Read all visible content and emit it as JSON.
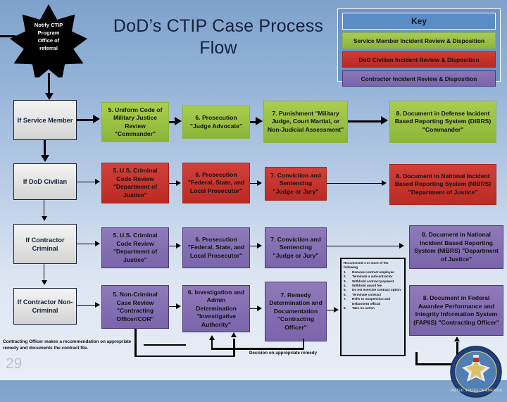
{
  "slide": {
    "title": "DoD’s CTIP Case Process Flow",
    "page_number": "29",
    "background_colors": {
      "top": "#7fa2cc",
      "bottom": "#e8eef7"
    }
  },
  "star_callout": {
    "name": "notify-ctip-star",
    "text": "Notify CTIP Program Office of referral",
    "lines": [
      "Notify CTIP",
      "Program",
      "Office of",
      "referral"
    ],
    "fill": "#000000",
    "text_color": "#ffffff"
  },
  "key": {
    "header": "Key",
    "items": [
      {
        "label": "Service Member Incident Review & Disposition",
        "color": "#a8cc4f",
        "swatch": "green"
      },
      {
        "label": "DoD Civilian Incident Review & Disposition",
        "color": "#cf3b33",
        "swatch": "red"
      },
      {
        "label": "Contractor Incident Review & Disposition",
        "color": "#8b76b8",
        "swatch": "purple"
      }
    ],
    "panel_color": "#6e93c8"
  },
  "rows": [
    {
      "id": "service-member",
      "swatch": "green",
      "entry": "If Service Member",
      "steps": [
        "5. Uniform Code of Military Justice Review \"Commander\"",
        "6. Prosecution \"Judge Advocate\"",
        "7. Punishment \"Military Judge, Court Martial, or Non-Judicial Assessment\"",
        "8. Document in Defense Incident Based Reporting System (DIBRS) \"Commander\""
      ]
    },
    {
      "id": "dod-civilian",
      "swatch": "red",
      "entry": "If DoD Civilian",
      "steps": [
        "5. U.S. Criminal Code Review \"Department of Justice\"",
        "6. Prosecution \"Federal, State, and Local Prosecutor\"",
        "7. Conviction and Sentencing \"Judge or Jury\"",
        "8. Document in National Incident Based Reporting System (NIBRS) \"Department of Justice\""
      ]
    },
    {
      "id": "contractor-criminal",
      "swatch": "purple",
      "entry": "If Contractor Criminal",
      "steps": [
        "5. U.S. Criminal Code Review \"Department of Justice\"",
        "6. Prosecution \"Federal, State, and Local Prosecutor\"",
        "7. Conviction and Sentencing \"Judge or Jury\"",
        "8. Document in National Incident Based Reporting System (NIBRS) \"Department of Justice\""
      ]
    },
    {
      "id": "contractor-non-criminal",
      "swatch": "purple",
      "entry": "If Contractor Non-Criminal",
      "steps": [
        "5. Non-Criminal Case Review \"Contracting Officer/COR\"",
        "6. Investigation and Admin Determination \"Investigative Authority\"",
        "7. Remedy Determination and Documentation \"Contracting Officer\"",
        "8. Document in Federal Awardee Performance and Integrity Information System (FAPIIS) \"Contracting Officer\""
      ]
    }
  ],
  "recommendation_box": {
    "heading": "Recommend 1 or more of the following",
    "items": [
      {
        "num": "1.",
        "text": "Remove contract employee"
      },
      {
        "num": "2.",
        "text": "Terminate a subcontractor"
      },
      {
        "num": "3.",
        "text": "Withhold contract payment"
      },
      {
        "num": "4.",
        "text": "Withhold award fee"
      },
      {
        "num": "5.",
        "text": "Do not exercise contract option"
      },
      {
        "num": "6.",
        "text": "Terminate contract"
      },
      {
        "num": "7.",
        "text": "Refer to Suspension and Debarment official"
      },
      {
        "num": "8.",
        "text": "Take no action"
      }
    ]
  },
  "notes": {
    "contracting_officer": "Contracting Officer makes a recommendation on appropriate remedy and documents the contract file.",
    "decision": "Decision on appropriate remedy"
  },
  "seal": {
    "name": "dod-seal",
    "alt": "United States of America Department of Defense seal"
  }
}
